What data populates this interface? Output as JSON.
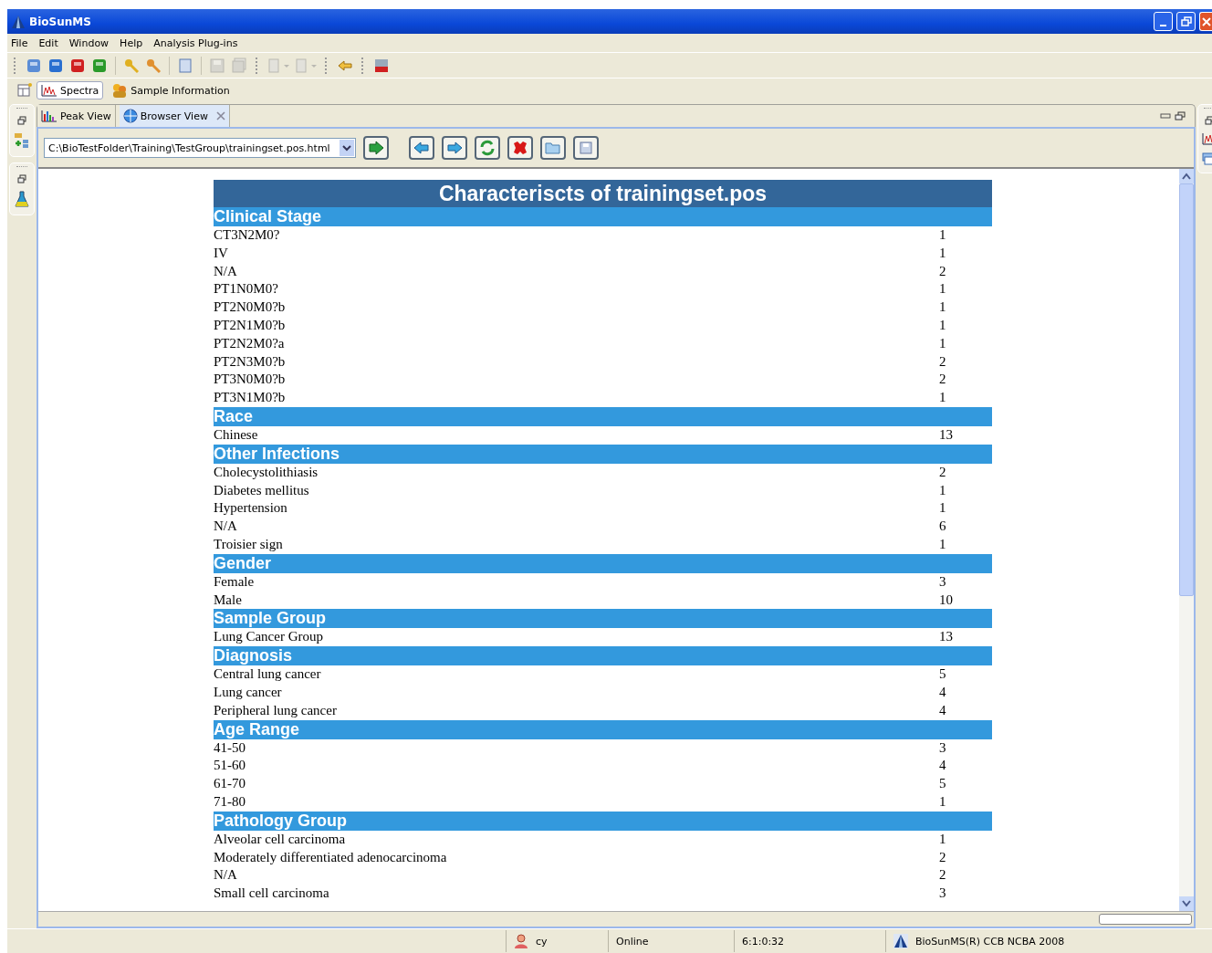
{
  "window": {
    "title": "BioSunMS"
  },
  "menu": [
    {
      "label": "File"
    },
    {
      "label": "Edit"
    },
    {
      "label": "Window"
    },
    {
      "label": "Help"
    },
    {
      "label": "Analysis Plug-ins"
    }
  ],
  "perspectives": [
    {
      "label": "Spectra",
      "selected": true
    },
    {
      "label": "Sample Information",
      "selected": false
    }
  ],
  "view_tabs": [
    {
      "label": "Peak View",
      "selected": false
    },
    {
      "label": "Browser View",
      "selected": true
    }
  ],
  "address": {
    "value": "C:\\BioTestFolder\\Training\\TestGroup\\trainingset.pos.html"
  },
  "report": {
    "title": "Characteriscts of trainingset.pos",
    "sections": [
      {
        "title": "Clinical Stage",
        "rows": [
          {
            "label": "CT3N2M0?",
            "count": "1"
          },
          {
            "label": "IV",
            "count": "1"
          },
          {
            "label": "N/A",
            "count": "2"
          },
          {
            "label": "PT1N0M0?",
            "count": "1"
          },
          {
            "label": "PT2N0M0?b",
            "count": "1"
          },
          {
            "label": "PT2N1M0?b",
            "count": "1"
          },
          {
            "label": "PT2N2M0?a",
            "count": "1"
          },
          {
            "label": "PT2N3M0?b",
            "count": "2"
          },
          {
            "label": "PT3N0M0?b",
            "count": "2"
          },
          {
            "label": "PT3N1M0?b",
            "count": "1"
          }
        ]
      },
      {
        "title": "Race",
        "rows": [
          {
            "label": "Chinese",
            "count": "13"
          }
        ]
      },
      {
        "title": "Other Infections",
        "rows": [
          {
            "label": "Cholecystolithiasis",
            "count": "2"
          },
          {
            "label": "Diabetes mellitus",
            "count": "1"
          },
          {
            "label": "Hypertension",
            "count": "1"
          },
          {
            "label": "N/A",
            "count": "6"
          },
          {
            "label": "Troisier sign",
            "count": "1"
          }
        ]
      },
      {
        "title": "Gender",
        "rows": [
          {
            "label": "Female",
            "count": "3"
          },
          {
            "label": "Male",
            "count": "10"
          }
        ]
      },
      {
        "title": "Sample Group",
        "rows": [
          {
            "label": "Lung Cancer Group",
            "count": "13"
          }
        ]
      },
      {
        "title": "Diagnosis",
        "rows": [
          {
            "label": "Central lung cancer",
            "count": "5"
          },
          {
            "label": "Lung cancer",
            "count": "4"
          },
          {
            "label": "Peripheral lung cancer",
            "count": "4"
          }
        ]
      },
      {
        "title": "Age Range",
        "rows": [
          {
            "label": "41-50",
            "count": "3"
          },
          {
            "label": "51-60",
            "count": "4"
          },
          {
            "label": "61-70",
            "count": "5"
          },
          {
            "label": "71-80",
            "count": "1"
          }
        ]
      },
      {
        "title": "Pathology Group",
        "rows": [
          {
            "label": "Alveolar cell carcinoma",
            "count": "1"
          },
          {
            "label": "Moderately differentiated adenocarcinoma",
            "count": "2"
          },
          {
            "label": "N/A",
            "count": "2"
          },
          {
            "label": "Small cell carcinoma",
            "count": "3"
          }
        ]
      }
    ]
  },
  "status_bar": {
    "user": "cy",
    "connection": "Online",
    "time": "6:1:0:32",
    "product": "BioSunMS(R) CCB NCBA 2008"
  }
}
